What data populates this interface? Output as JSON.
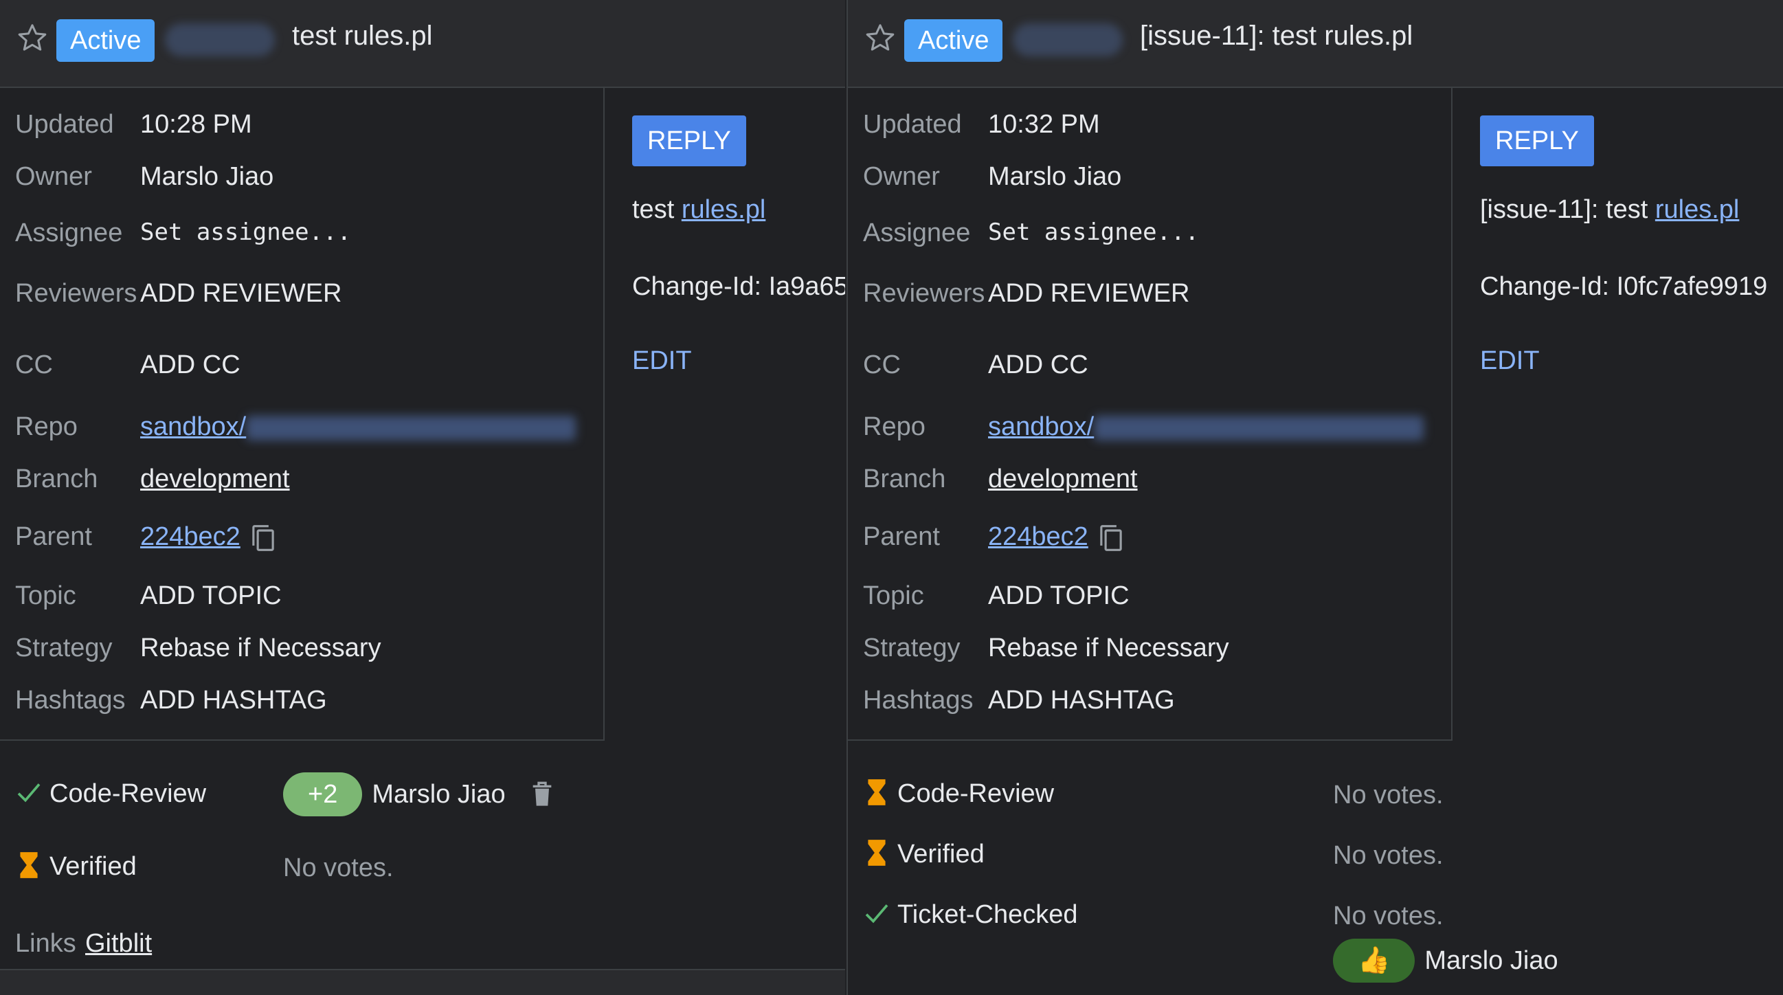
{
  "left": {
    "status": "Active",
    "title": "test rules.pl",
    "updated_label": "Updated",
    "updated_value": "10:28 PM",
    "owner_label": "Owner",
    "owner_value": "Marslo Jiao",
    "assignee_label": "Assignee",
    "assignee_placeholder": "Set assignee...",
    "reviewers_label": "Reviewers",
    "reviewers_action": "ADD REVIEWER",
    "cc_label": "CC",
    "cc_action": "ADD CC",
    "repo_label": "Repo",
    "repo_value": "sandbox/",
    "branch_label": "Branch",
    "branch_value": "development",
    "parent_label": "Parent",
    "parent_value": "224bec2",
    "topic_label": "Topic",
    "topic_action": "ADD TOPIC",
    "strategy_label": "Strategy",
    "strategy_value": "Rebase if Necessary",
    "hashtags_label": "Hashtags",
    "hashtags_action": "ADD HASHTAG",
    "labels": [
      {
        "name": "Code-Review",
        "vote": "+2",
        "voter": "Marslo Jiao"
      },
      {
        "name": "Verified",
        "value": "No votes."
      }
    ],
    "links_label": "Links",
    "links_value": "Gitblit",
    "reply_label": "REPLY",
    "message_prefix": "test ",
    "message_link": "rules.pl",
    "change_id": "Change-Id: Ia9a65",
    "edit_label": "EDIT"
  },
  "right": {
    "status": "Active",
    "title": "[issue-11]: test rules.pl",
    "updated_label": "Updated",
    "updated_value": "10:32 PM",
    "owner_label": "Owner",
    "owner_value": "Marslo Jiao",
    "assignee_label": "Assignee",
    "assignee_placeholder": "Set assignee...",
    "reviewers_label": "Reviewers",
    "reviewers_action": "ADD REVIEWER",
    "cc_label": "CC",
    "cc_action": "ADD CC",
    "repo_label": "Repo",
    "repo_value": "sandbox/",
    "branch_label": "Branch",
    "branch_value": "development",
    "parent_label": "Parent",
    "parent_value": "224bec2",
    "topic_label": "Topic",
    "topic_action": "ADD TOPIC",
    "strategy_label": "Strategy",
    "strategy_value": "Rebase if Necessary",
    "hashtags_label": "Hashtags",
    "hashtags_action": "ADD HASHTAG",
    "labels": [
      {
        "name": "Code-Review",
        "value": "No votes."
      },
      {
        "name": "Verified",
        "value": "No votes."
      },
      {
        "name": "Ticket-Checked",
        "value": "No votes.",
        "vote": "👍",
        "voter": "Marslo Jiao"
      }
    ],
    "reply_label": "REPLY",
    "message_prefix": "[issue-11]: test ",
    "message_link": "rules.pl",
    "change_id": "Change-Id: I0fc7afe9919",
    "edit_label": "EDIT"
  },
  "colors": {
    "background": "#202124",
    "accent_link": "#8ab4f8",
    "active_badge": "#4a9ff5",
    "reply_button": "#4a84e8",
    "vote_approved": "#7cb773",
    "hourglass": "#f29900",
    "check": "#5bb974"
  }
}
